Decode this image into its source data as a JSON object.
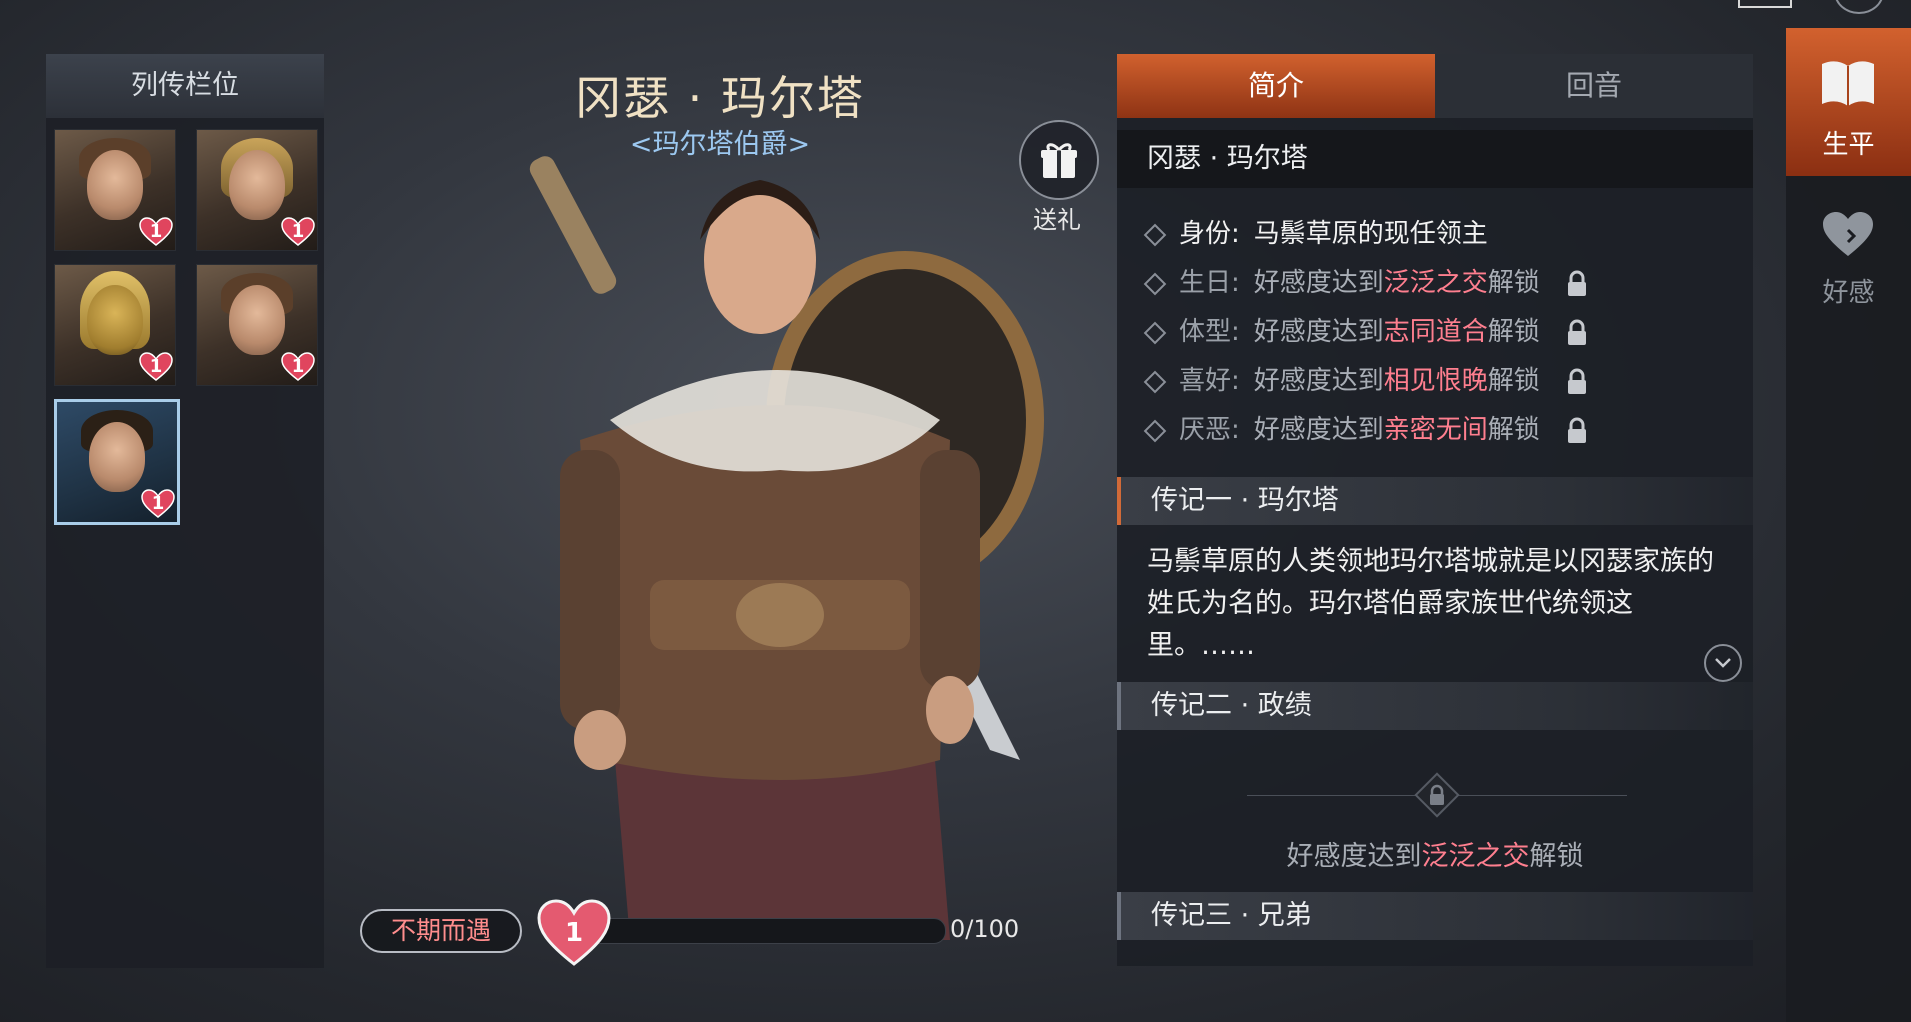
{
  "roster": {
    "title": "列传栏位",
    "portraits": [
      {
        "name": "portrait-1",
        "level": "1",
        "selected": false
      },
      {
        "name": "portrait-2",
        "level": "1",
        "selected": false
      },
      {
        "name": "portrait-3",
        "level": "1",
        "selected": false
      },
      {
        "name": "portrait-4",
        "level": "1",
        "selected": false
      },
      {
        "name": "portrait-5",
        "level": "1",
        "selected": true
      }
    ]
  },
  "character": {
    "name": "冈瑟 · 玛尔塔",
    "title": "<玛尔塔伯爵>",
    "gift_label": "送礼",
    "relation": "不期而遇",
    "favor_level": "1",
    "favor_progress": "0/100",
    "favor_fraction": 0
  },
  "info": {
    "tabs": [
      "简介",
      "回音"
    ],
    "active_tab": "简介",
    "name_bar": "冈瑟 · 玛尔塔",
    "attributes": [
      {
        "label": "身份:",
        "value": "马鬃草原的现任领主",
        "locked": false
      },
      {
        "label": "生日:",
        "pre": "好感度达到",
        "hl": "泛泛之交",
        "post": "解锁",
        "locked": true
      },
      {
        "label": "体型:",
        "pre": "好感度达到",
        "hl": "志同道合",
        "post": "解锁",
        "locked": true
      },
      {
        "label": "喜好:",
        "pre": "好感度达到",
        "hl": "相见恨晚",
        "post": "解锁",
        "locked": true
      },
      {
        "label": "厌恶:",
        "pre": "好感度达到",
        "hl": "亲密无间",
        "post": "解锁",
        "locked": true
      }
    ],
    "sections": [
      {
        "title": "传记一 · 玛尔塔"
      },
      {
        "title": "传记二 · 政绩"
      },
      {
        "title": "传记三 · 兄弟"
      }
    ],
    "bio": "马鬃草原的人类领地玛尔塔城就是以冈瑟家族的姓氏为名的。玛尔塔伯爵家族世代统领这里。……",
    "locked_section": {
      "pre": "好感度达到",
      "hl": "泛泛之交",
      "post": "解锁"
    }
  },
  "side_nav": {
    "items": [
      {
        "label": "生平",
        "icon": "book-icon",
        "active": true
      },
      {
        "label": "好感",
        "icon": "heart-icon",
        "active": false
      }
    ]
  },
  "colors": {
    "accent_orange": "#d1612e",
    "highlight_pink": "#ff7f8f",
    "title_gold": "#f0e1c4",
    "title_blue": "#9cc8f0"
  }
}
